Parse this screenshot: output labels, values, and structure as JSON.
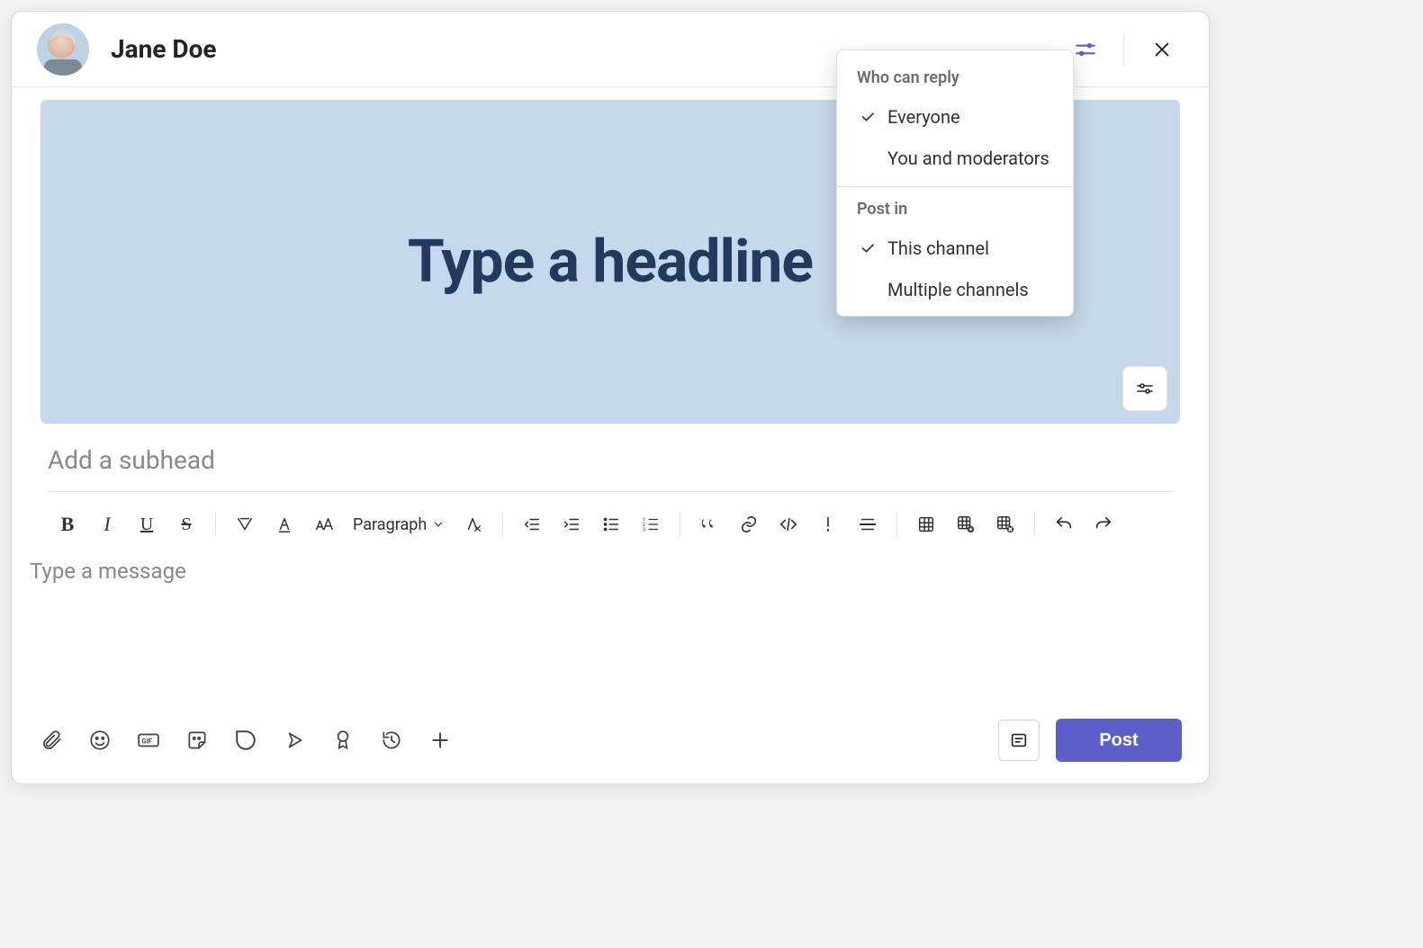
{
  "header": {
    "author_name": "Jane Doe"
  },
  "banner": {
    "headline_placeholder": "Type a headline"
  },
  "subhead": {
    "placeholder": "Add a subhead"
  },
  "toolbar": {
    "paragraph_label": "Paragraph"
  },
  "message": {
    "placeholder": "Type a message"
  },
  "footer": {
    "post_label": "Post"
  },
  "popup": {
    "reply_section_label": "Who can reply",
    "reply_options": [
      {
        "label": "Everyone",
        "selected": true
      },
      {
        "label": "You and moderators",
        "selected": false
      }
    ],
    "post_in_section_label": "Post in",
    "post_in_options": [
      {
        "label": "This channel",
        "selected": true
      },
      {
        "label": "Multiple channels",
        "selected": false
      }
    ]
  },
  "icons": {
    "settings": "settings-sliders",
    "close": "close",
    "banner_settings": "settings-sliders",
    "attach": "paperclip",
    "emoji": "smiley",
    "gif": "gif",
    "sticker": "sticker",
    "loop": "loop",
    "stream": "stream",
    "praise": "praise-badge",
    "updates": "updates",
    "more_apps": "plus",
    "collapse": "collapse-compose"
  }
}
